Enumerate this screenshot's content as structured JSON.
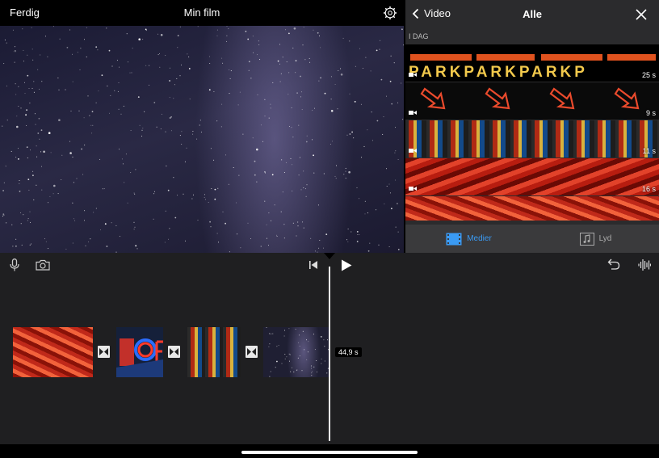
{
  "header": {
    "done_label": "Ferdig",
    "title": "Min film",
    "settings_icon": "gear-icon"
  },
  "media_panel": {
    "back_label": "Video",
    "title": "Alle",
    "section_label": "I DAG",
    "clips": [
      {
        "name": "park-sign",
        "duration": "25 s",
        "text": "PARKPARKPARKP"
      },
      {
        "name": "neon-arrows",
        "duration": "9 s"
      },
      {
        "name": "city-signs",
        "duration": "11 s"
      },
      {
        "name": "red-lights",
        "duration": "16 s"
      },
      {
        "name": "red-fan-lights",
        "duration": ""
      }
    ],
    "tabs": [
      {
        "label": "Medier",
        "icon": "film-icon",
        "active": true
      },
      {
        "label": "Lyd",
        "icon": "music-note-icon",
        "active": false
      }
    ]
  },
  "timeline": {
    "duration_badge": "44,9 s",
    "clip_names": [
      "red-fan-lights",
      "neon-open-sign",
      "city-signs",
      "milky-way"
    ]
  },
  "colors": {
    "accent": "#3a9af3",
    "panel_bg": "#2b2b2d",
    "timeline_bg": "#1f1f21"
  }
}
